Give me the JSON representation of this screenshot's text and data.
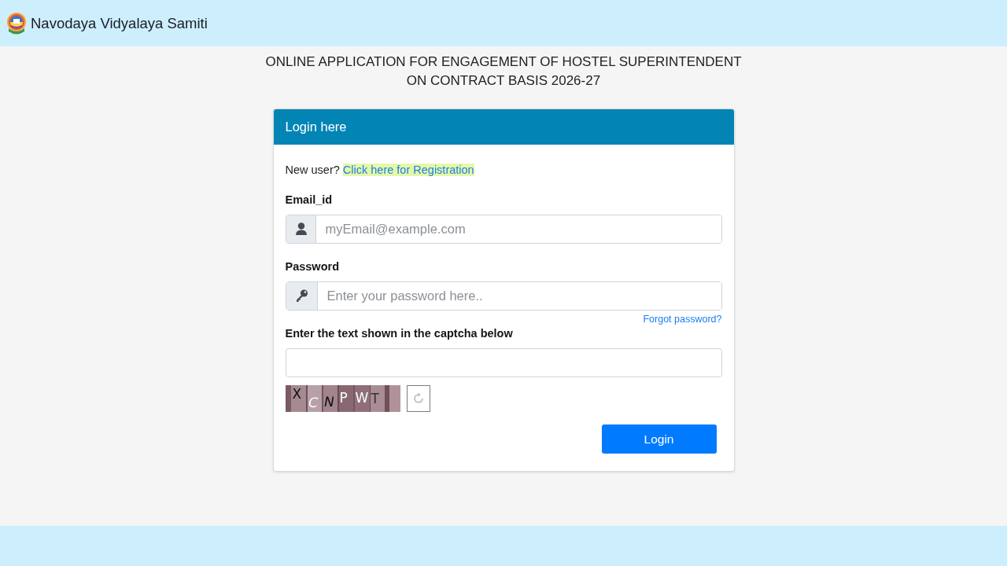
{
  "header": {
    "site_title": "Navodaya Vidyalaya Samiti"
  },
  "page_heading": [
    "ONLINE APPLICATION FOR ENGAGEMENT OF HOSTEL SUPERINTENDENT",
    "ON CONTRACT BASIS 2026-27"
  ],
  "login_card": {
    "title": "Login here",
    "new_user_text": "New user?",
    "registration_link": "Click here for Registration",
    "fields": [
      {
        "kind": "email",
        "label": "Email_id",
        "placeholder": "myEmail@example.com"
      },
      {
        "kind": "password",
        "label": "Password",
        "placeholder": "Enter your password here..",
        "link": "Forgot password?"
      },
      {
        "kind": "captcha",
        "label": "Enter the text shown in the captcha below",
        "captcha_characters": [
          "X",
          "C",
          "N",
          "P",
          "W",
          "T"
        ]
      }
    ],
    "button": "Login"
  }
}
